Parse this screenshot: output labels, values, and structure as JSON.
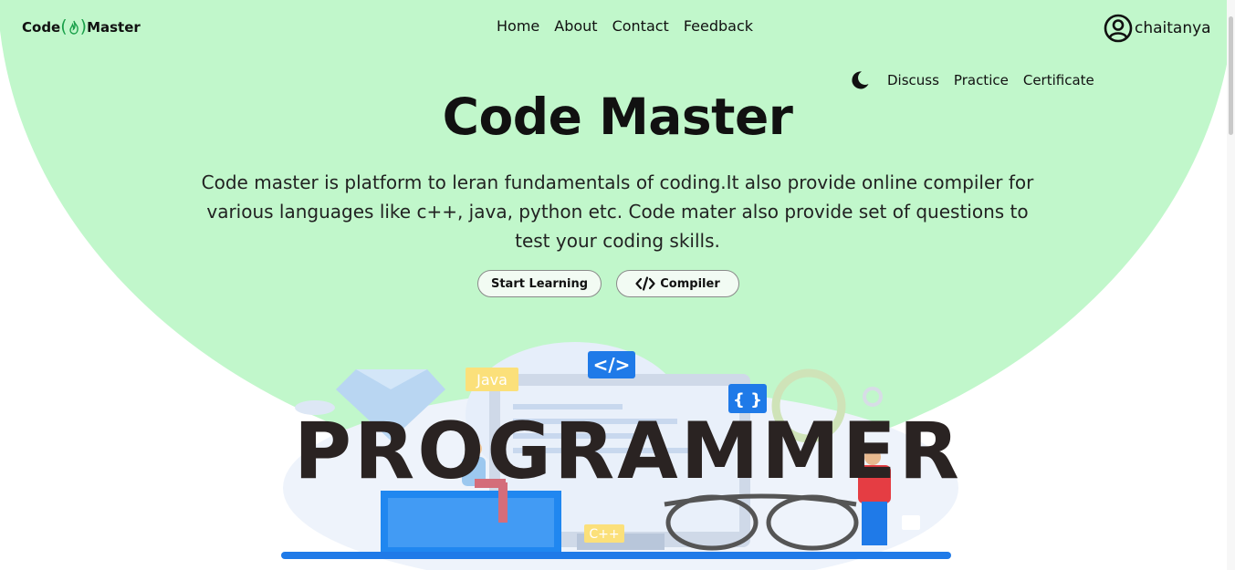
{
  "app": {
    "logo_left": "Code",
    "logo_right": "Master",
    "logo_icon": "flame-icon",
    "accent_color": "#c1f7cb",
    "brand_green": "#1aa04a"
  },
  "nav": {
    "items": [
      {
        "label": "Home"
      },
      {
        "label": "About"
      },
      {
        "label": "Contact"
      },
      {
        "label": "Feedback"
      }
    ]
  },
  "user": {
    "name": "chaitanya",
    "icon": "user-circle-icon"
  },
  "subnav": {
    "theme_icon": "moon-icon",
    "items": [
      {
        "label": "Discuss"
      },
      {
        "label": "Practice"
      },
      {
        "label": "Certificate"
      }
    ]
  },
  "hero": {
    "title": "Code Master",
    "description": "Code master is platform to leran fundamentals of coding.It also provide online compiler for various languages like c++, java, python etc. Code mater also provide set of questions to test your coding skills.",
    "buttons": {
      "start_learning": "Start Learning",
      "compiler": "Compiler",
      "compiler_icon": "code-brackets-icon"
    }
  },
  "illustration": {
    "heading": "PROGRAMMER",
    "tag_java": "Java",
    "tag_cpp": "C++",
    "tag_code": "</>",
    "tag_braces": "{ }"
  }
}
